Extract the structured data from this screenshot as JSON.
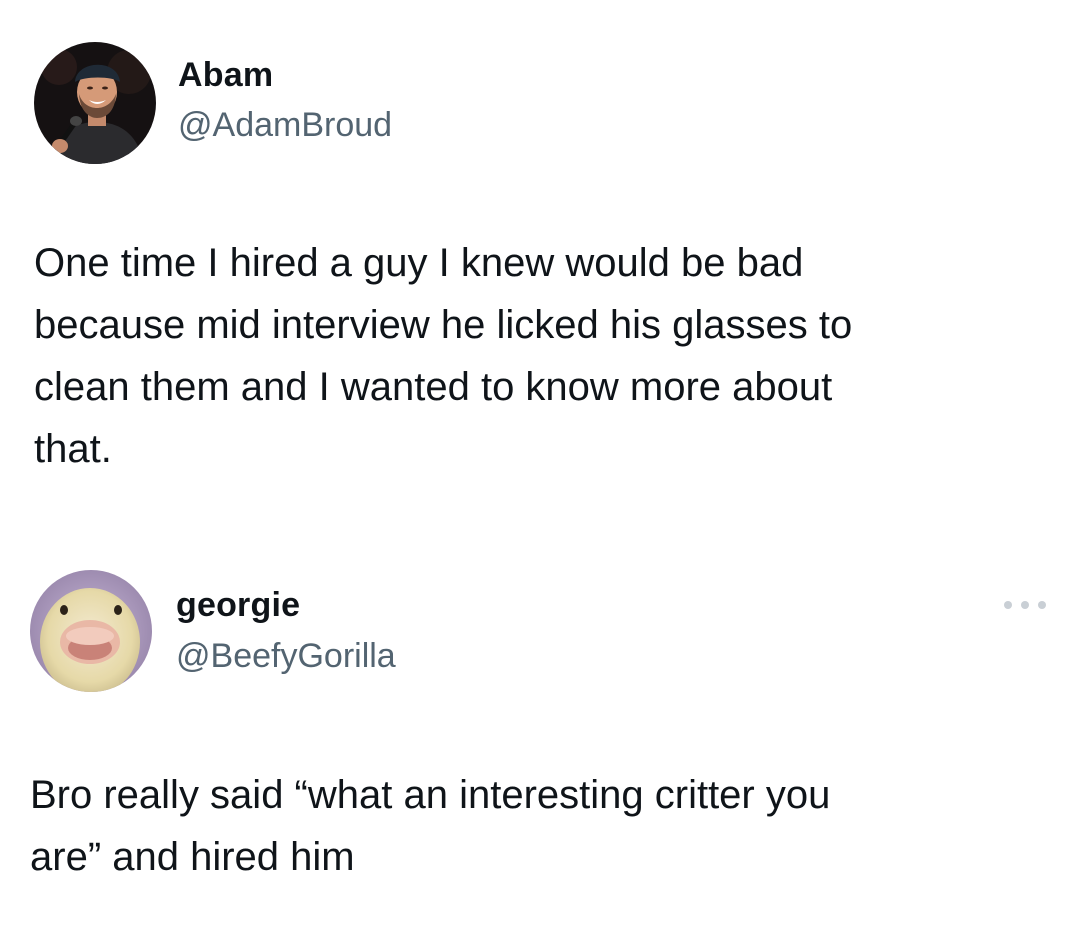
{
  "tweets": [
    {
      "display_name": "Abam",
      "handle": "@AdamBroud",
      "text": "One time I hired a guy I knew would be bad\nbecause mid interview he licked his glasses to\nclean them and I wanted to know more about\nthat.",
      "avatar_icon": "person-with-microphone-avatar"
    },
    {
      "display_name": "georgie",
      "handle": "@BeefyGorilla",
      "text": "Bro really said “what an interesting critter you\nare” and hired him",
      "avatar_icon": "duck-avatar",
      "more_icon": "more-options-icon"
    }
  ],
  "colors": {
    "text": "#0f1419",
    "handle": "#536471",
    "more_dots": "#c9cfd5",
    "background": "#ffffff"
  }
}
